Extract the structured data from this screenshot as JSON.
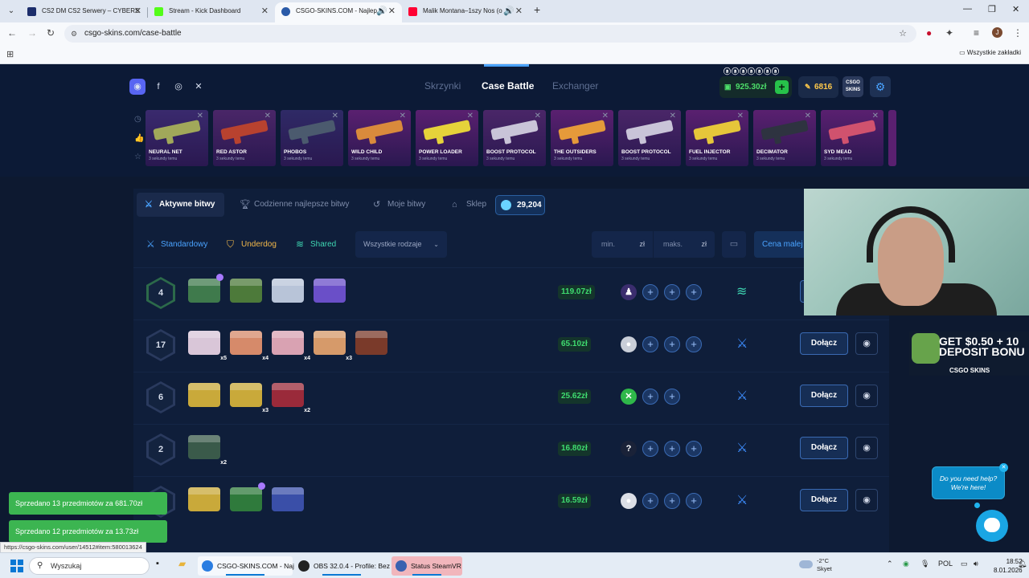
{
  "browser": {
    "tabs": [
      {
        "title": "CS2 DM CS2 Serwery – CYBERS",
        "color": "#1c2d6b",
        "active": false
      },
      {
        "title": "Stream - Kick Dashboard",
        "color": "#53fc18",
        "active": false
      },
      {
        "title": "CSGO-SKINS.COM - Najlep",
        "color": "#2a5aa8",
        "active": true
      },
      {
        "title": "Malik Montana–1szy Nos (o",
        "color": "#ff0033",
        "active": false
      }
    ],
    "url": "csgo-skins.com/case-battle",
    "bookmarks_all": "Wszystkie zakładki"
  },
  "site": {
    "nav": [
      {
        "label": "Skrzynki",
        "active": false
      },
      {
        "label": "Case Battle",
        "active": true
      },
      {
        "label": "Exchanger",
        "active": false
      }
    ],
    "balance": "925.30zł",
    "gems": "6816",
    "avatar_label": "CSGO SKINS",
    "username": "ⓐⓐⓐⓐⓐⓐⓐ"
  },
  "drops": [
    {
      "name": "NEURAL NET",
      "sub": "3 sekundy temu",
      "bg": "#3a2a6e",
      "gun": "#a1a85a"
    },
    {
      "name": "RED ASTOR",
      "sub": "3 sekundy temu",
      "bg": "#4a2668",
      "gun": "#b8422f"
    },
    {
      "name": "PHOBOS",
      "sub": "3 sekundy temu",
      "bg": "#2f2a66",
      "gun": "#4b5a6e"
    },
    {
      "name": "WILD CHILD",
      "sub": "3 sekundy temu",
      "bg": "#5a2070",
      "gun": "#d98a3c"
    },
    {
      "name": "POWER LOADER",
      "sub": "3 sekundy temu",
      "bg": "#5a2070",
      "gun": "#e6d23a"
    },
    {
      "name": "BOOST PROTOCOL",
      "sub": "3 sekundy temu",
      "bg": "#4a2668",
      "gun": "#c9c4d8"
    },
    {
      "name": "THE OUTSIDERS",
      "sub": "3 sekundy temu",
      "bg": "#5a2070",
      "gun": "#e59a3a"
    },
    {
      "name": "BOOST PROTOCOL",
      "sub": "3 sekundy temu",
      "bg": "#4a2668",
      "gun": "#c9c4d8"
    },
    {
      "name": "FUEL INJECTOR",
      "sub": "3 sekundy temu",
      "bg": "#5a2070",
      "gun": "#e6c63a"
    },
    {
      "name": "DECIMATOR",
      "sub": "3 sekundy temu",
      "bg": "#5a2070",
      "gun": "#2e3340"
    },
    {
      "name": "SYD MEAD",
      "sub": "3 sekundy temu",
      "bg": "#5a2070",
      "gun": "#d0526e"
    }
  ],
  "subtabs": [
    {
      "label": "Aktywne bitwy",
      "icon": "swords-icon",
      "active": true
    },
    {
      "label": "Codzienne najlepsze bitwy",
      "icon": "trophy-icon",
      "active": false
    },
    {
      "label": "Moje bitwy",
      "icon": "history-icon",
      "active": false
    },
    {
      "label": "Sklep",
      "icon": "shop-icon",
      "active": false
    }
  ],
  "coins": "29,204",
  "filters": {
    "modes": [
      {
        "label": "Standardowy",
        "color": "#4aa3ff"
      },
      {
        "label": "Underdog",
        "color": "#f2b84a"
      },
      {
        "label": "Shared",
        "color": "#3ed6b2"
      }
    ],
    "select": "Wszystkie rodzaje",
    "min": "min.",
    "max": "maks.",
    "unit": "zł",
    "sort": "Cena malej"
  },
  "battles": [
    {
      "rounds": "4",
      "price": "119.07zł",
      "mode": "shared",
      "join": "",
      "green": true,
      "cases": [
        {
          "c": "#3f7a4c",
          "m": "",
          "b": true
        },
        {
          "c": "#4d7a3a",
          "m": "",
          "b": false
        },
        {
          "c": "#b8c4d8",
          "m": "",
          "b": false
        },
        {
          "c": "#6a4fc8",
          "m": "",
          "b": false
        }
      ],
      "players": [
        {
          "t": "♟",
          "c": "#3b2d6e"
        }
      ],
      "slots": 3
    },
    {
      "rounds": "17",
      "price": "65.10zł",
      "mode": "standard",
      "join": "Dołącz",
      "green": false,
      "cases": [
        {
          "c": "#d9c6d8",
          "m": "x5",
          "b": false
        },
        {
          "c": "#d68a6a",
          "m": "x4",
          "b": false
        },
        {
          "c": "#d9a2b2",
          "m": "x4",
          "b": false
        },
        {
          "c": "#d69a6a",
          "m": "x3",
          "b": false
        },
        {
          "c": "#7a3a2a",
          "m": "",
          "b": false
        }
      ],
      "players": [
        {
          "t": "●",
          "c": "#c9ced8"
        }
      ],
      "slots": 3
    },
    {
      "rounds": "6",
      "price": "25.62zł",
      "mode": "standard",
      "join": "Dołącz",
      "green": false,
      "cases": [
        {
          "c": "#c9a93a",
          "m": "",
          "b": false
        },
        {
          "c": "#c9a93a",
          "m": "x3",
          "b": false
        },
        {
          "c": "#9a2a3a",
          "m": "x2",
          "b": false
        }
      ],
      "players": [
        {
          "t": "✕",
          "c": "#2fb84a"
        }
      ],
      "slots": 2
    },
    {
      "rounds": "2",
      "price": "16.80zł",
      "mode": "standard",
      "join": "Dołącz",
      "green": false,
      "cases": [
        {
          "c": "#3a5a4a",
          "m": "x2",
          "b": false
        }
      ],
      "players": [
        {
          "t": "?",
          "c": "#1a2238"
        }
      ],
      "slots": 3
    },
    {
      "rounds": "",
      "price": "16.59zł",
      "mode": "standard",
      "join": "Dołącz",
      "green": false,
      "cases": [
        {
          "c": "#c9a93a",
          "m": "",
          "b": false
        },
        {
          "c": "#2f7a3c",
          "m": "",
          "b": true
        },
        {
          "c": "#3a4fa8",
          "m": "",
          "b": false
        }
      ],
      "players": [
        {
          "t": "●",
          "c": "#dcdfe6"
        }
      ],
      "slots": 3
    }
  ],
  "overlays": {
    "promo_line1": "GET $0.50 + 10",
    "promo_line2": "DEPOSIT BONU",
    "promo_brand": "CSGO SKINS",
    "help": "Do you need help? We're here!",
    "toasts": [
      "Sprzedano 13 przedmiotów za 681.70zł",
      "Sprzedano 12 przedmiotów za 13.73zł"
    ],
    "status_url": "https://csgo-skins.com/user/14512#item:580013624"
  },
  "taskbar": {
    "search": "Wyszukaj",
    "apps": [
      {
        "label": "CSGO-SKINS.COM - Naj",
        "color": "#2a7de1",
        "open": true
      },
      {
        "label": "OBS 32.0.4 - Profile: Bez",
        "color": "#222",
        "open": true
      },
      {
        "label": "Status SteamVR",
        "color": "#3a62b0",
        "open": true
      }
    ],
    "weather_temp": "-2°C",
    "weather_desc": "Skyet",
    "lang": "POL",
    "time": "18:52",
    "date": "8.01.2026"
  }
}
